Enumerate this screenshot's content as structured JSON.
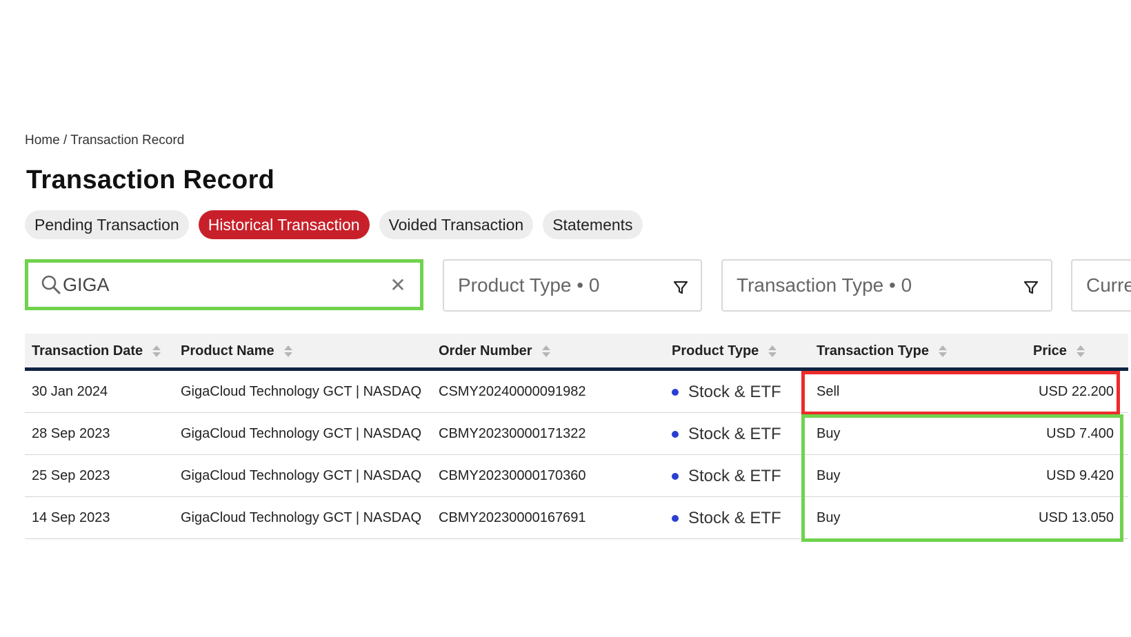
{
  "breadcrumb": "Home / Transaction Record",
  "page_title": "Transaction Record",
  "tabs": [
    {
      "label": "Pending Transaction",
      "active": false
    },
    {
      "label": "Historical Transaction",
      "active": true
    },
    {
      "label": "Voided Transaction",
      "active": false
    },
    {
      "label": "Statements",
      "active": false
    }
  ],
  "search": {
    "value": "GIGA",
    "clear_icon": "close-icon",
    "icon": "search-icon"
  },
  "filters": [
    {
      "label": "Product Type • 0",
      "icon": "filter-icon"
    },
    {
      "label": "Transaction Type • 0",
      "icon": "filter-icon"
    },
    {
      "label": "Curre"
    }
  ],
  "table": {
    "columns": [
      "Transaction Date",
      "Product Name",
      "Order Number",
      "Product Type",
      "Transaction Type",
      "Price"
    ],
    "rows": [
      {
        "date": "30 Jan 2024",
        "product": "GigaCloud Technology GCT | NASDAQ",
        "order": "CSMY20240000091982",
        "ptype": "Stock & ETF",
        "ttype": "Sell",
        "price": "USD 22.200"
      },
      {
        "date": "28 Sep 2023",
        "product": "GigaCloud Technology GCT | NASDAQ",
        "order": "CBMY20230000171322",
        "ptype": "Stock & ETF",
        "ttype": "Buy",
        "price": "USD 7.400"
      },
      {
        "date": "25 Sep 2023",
        "product": "GigaCloud Technology GCT | NASDAQ",
        "order": "CBMY20230000170360",
        "ptype": "Stock & ETF",
        "ttype": "Buy",
        "price": "USD 9.420"
      },
      {
        "date": "14 Sep 2023",
        "product": "GigaCloud Technology GCT | NASDAQ",
        "order": "CBMY20230000167691",
        "ptype": "Stock & ETF",
        "ttype": "Buy",
        "price": "USD 13.050"
      }
    ]
  },
  "colors": {
    "accent": "#c8202a",
    "highlight_red": "#ee2a2a",
    "highlight_green": "#6fd34d",
    "header_rule": "#0e2340",
    "bullet": "#2a3fd1"
  }
}
